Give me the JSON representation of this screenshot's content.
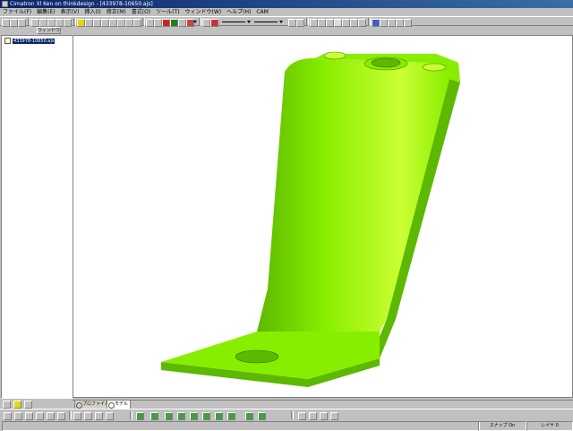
{
  "window": {
    "title": "Cimatron Xl Ken on thinkdesign - [433978-10650.ajs]"
  },
  "menu": {
    "items": [
      "ファイル(F)",
      "編集(E)",
      "表示(V)",
      "挿入(I)",
      "修正(M)",
      "書式(O)",
      "ツール(T)",
      "ウィンドウ(W)",
      "ヘルプ(H)",
      "CAM"
    ]
  },
  "subtoolbar": {
    "panel_button_label": "ウィンドウ"
  },
  "tree": {
    "root_label": "433978-10650.ajs"
  },
  "view_tabs": {
    "profile_label": "プロファイル",
    "model_label": "モデル"
  },
  "status": {
    "snap_label": "スナップ On",
    "layer_label": "レイヤ 0"
  },
  "model": {
    "fill_color": "#88ee00",
    "shadow_color": "#5cb800",
    "highlight_color": "#ccff33"
  }
}
